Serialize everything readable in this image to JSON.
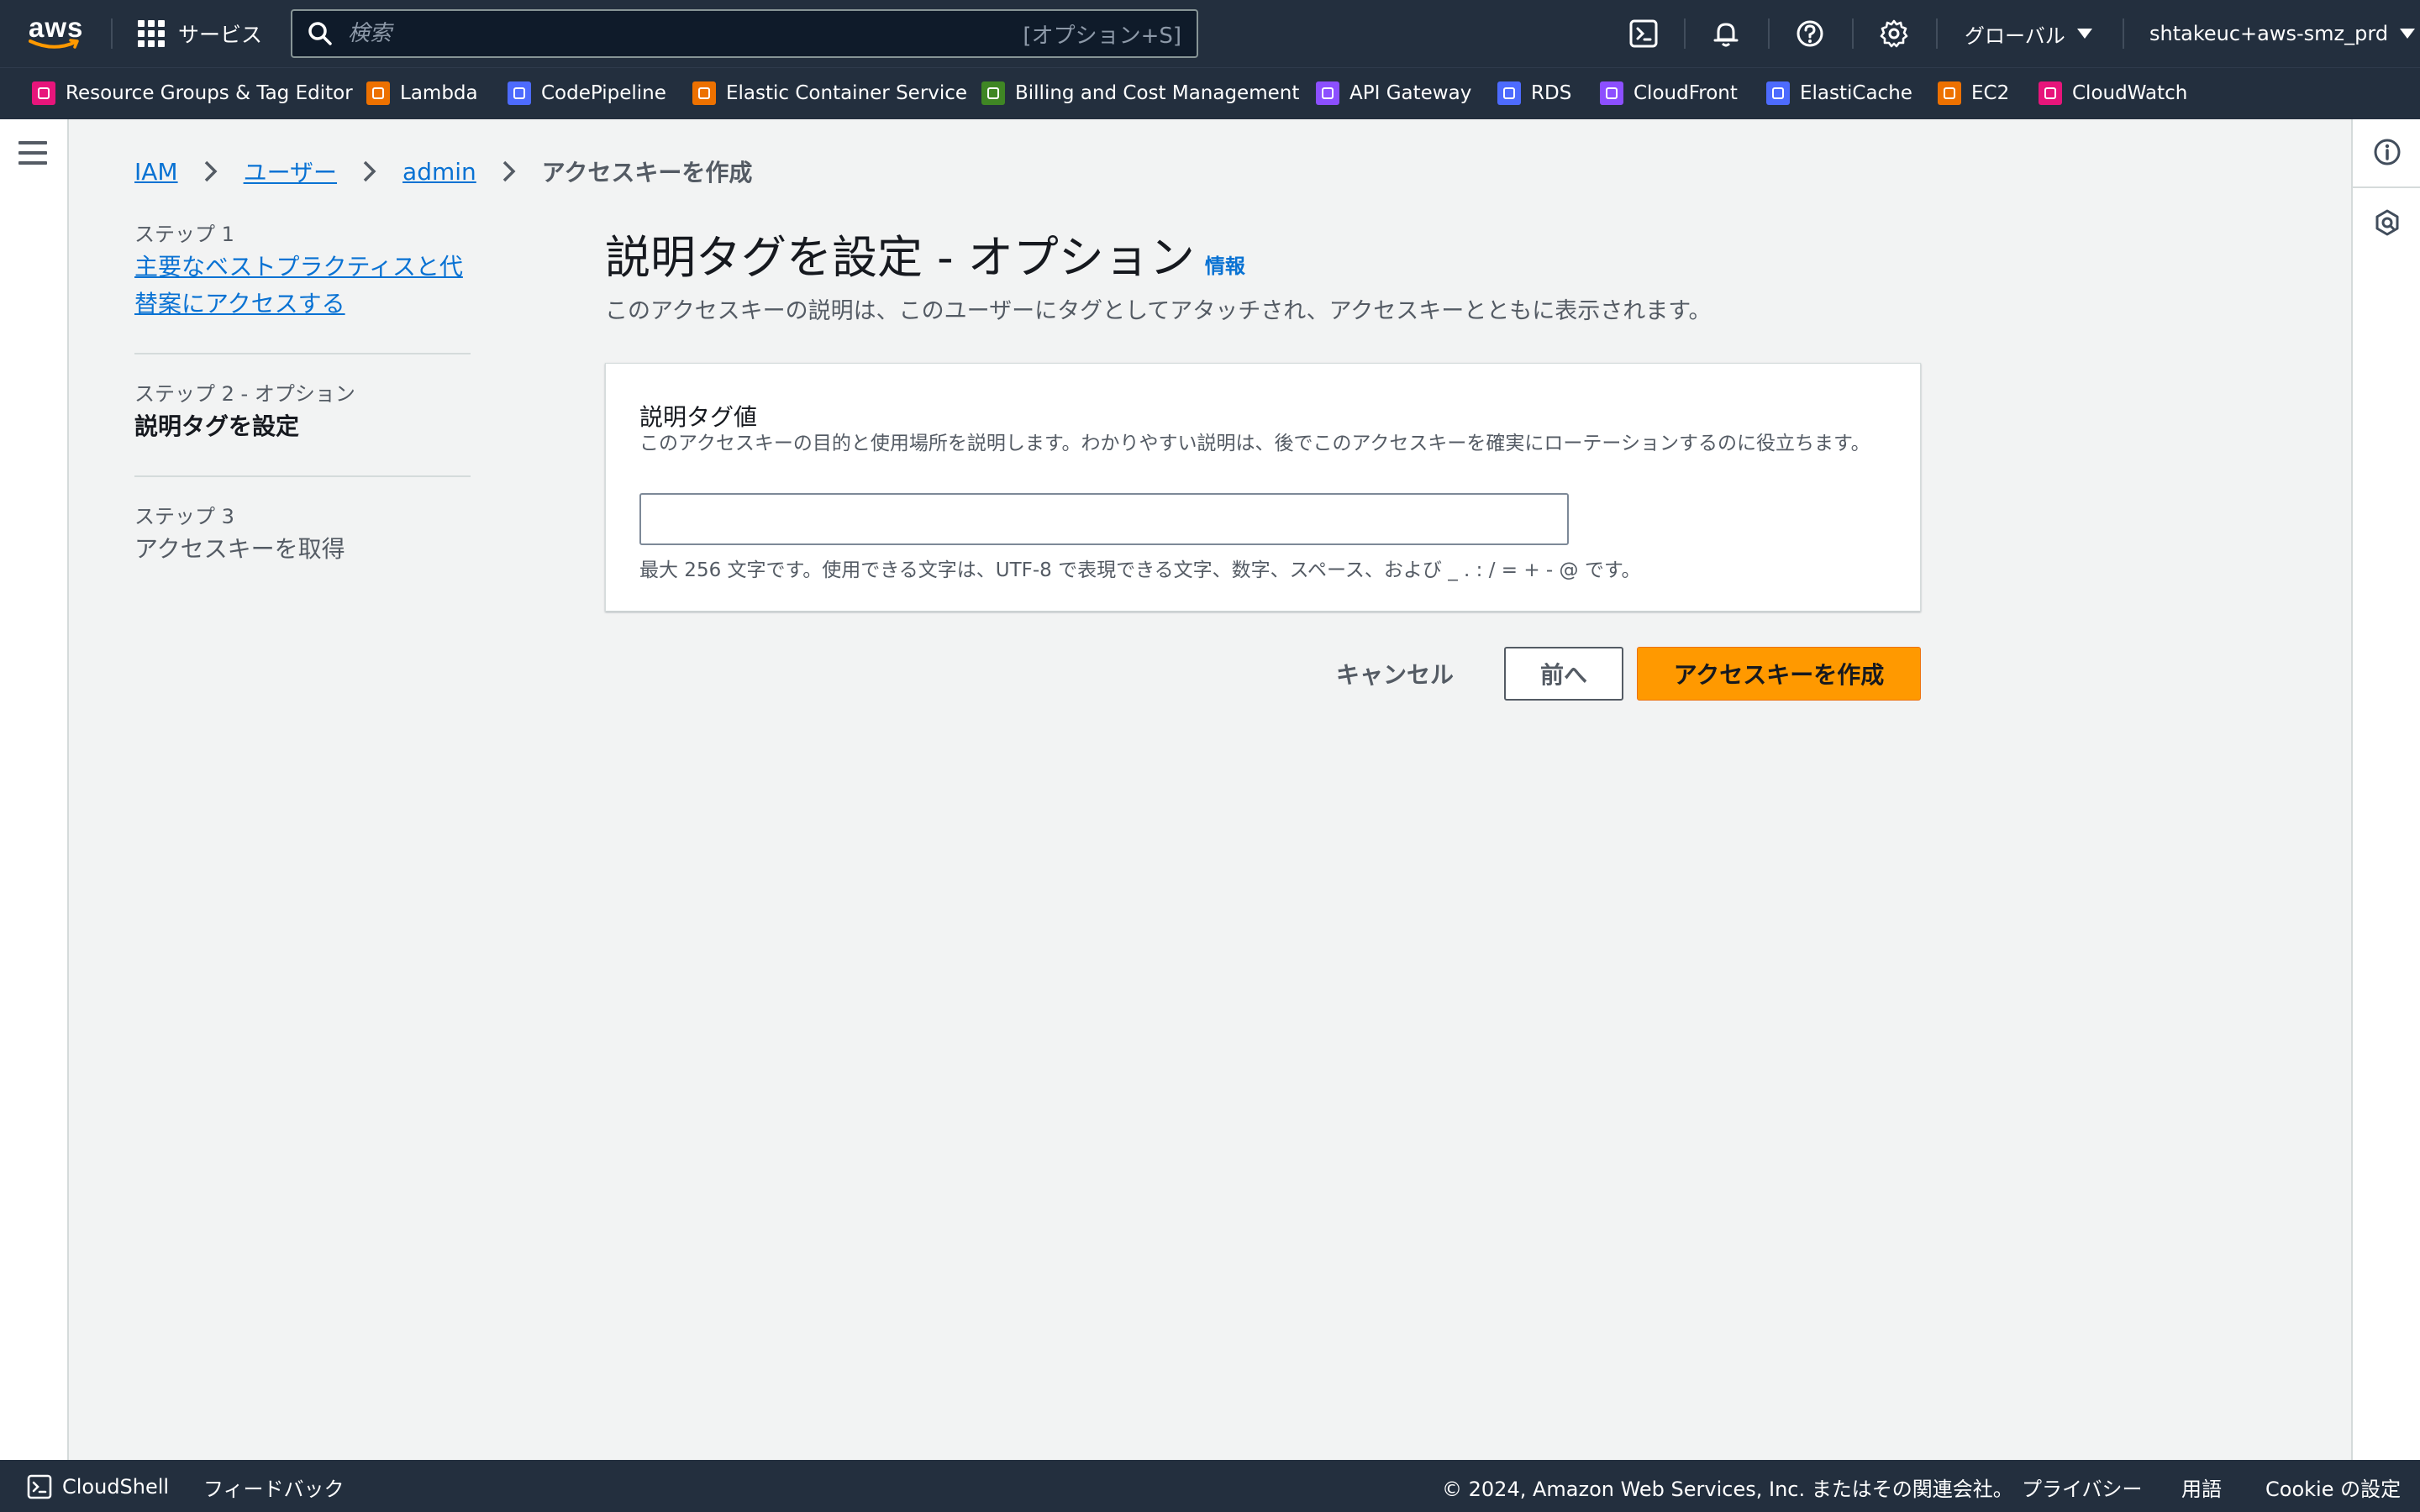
{
  "topnav": {
    "logo_text": "aws",
    "services_label": "サービス",
    "search_placeholder": "検索",
    "search_shortcut": "[オプション+S]",
    "region_label": "グローバル",
    "account_label": "shtakeuc+aws-smz_prd",
    "icons": [
      "cloudshell-icon",
      "bell-icon",
      "help-icon",
      "settings-icon"
    ]
  },
  "favorites": [
    {
      "label": "Resource Groups & Tag Editor",
      "color": "#e7157b"
    },
    {
      "label": "Lambda",
      "color": "#ed7100"
    },
    {
      "label": "CodePipeline",
      "color": "#4d6bfe"
    },
    {
      "label": "Elastic Container Service",
      "color": "#ed7100"
    },
    {
      "label": "Billing and Cost Management",
      "color": "#3f8624"
    },
    {
      "label": "API Gateway",
      "color": "#8c4fff"
    },
    {
      "label": "RDS",
      "color": "#4d6bfe"
    },
    {
      "label": "CloudFront",
      "color": "#8c4fff"
    },
    {
      "label": "ElastiCache",
      "color": "#4d6bfe"
    },
    {
      "label": "EC2",
      "color": "#ed7100"
    },
    {
      "label": "CloudWatch",
      "color": "#e7157b"
    }
  ],
  "breadcrumb": {
    "items": [
      "IAM",
      "ユーザー",
      "admin"
    ],
    "current": "アクセスキーを作成"
  },
  "steps": [
    {
      "label": "ステップ 1",
      "title": "主要なベストプラクティスと代替案にアクセスする",
      "title_line1": "主要なベストプラクティスと代",
      "title_line2": "替案にアクセスする",
      "state": "link"
    },
    {
      "label": "ステップ 2 - オプション",
      "title": "説明タグを設定",
      "state": "current"
    },
    {
      "label": "ステップ 3",
      "title": "アクセスキーを取得",
      "state": "disabled"
    }
  ],
  "main": {
    "title": "説明タグを設定 - オプション",
    "info_link": "情報",
    "description": "このアクセスキーの説明は、このユーザーにタグとしてアタッチされ、アクセスキーとともに表示されます。",
    "field": {
      "label": "説明タグ値",
      "description": "このアクセスキーの目的と使用場所を説明します。わかりやすい説明は、後でこのアクセスキーを確実にローテーションするのに役立ちます。",
      "value": "",
      "constraint": "最大 256 文字です。使用できる文字は、UTF-8 で表現できる文字、数字、スペース、および _ . : / = + - @ です。"
    },
    "buttons": {
      "cancel": "キャンセル",
      "previous": "前へ",
      "primary": "アクセスキーを作成"
    }
  },
  "footer": {
    "cloudshell": "CloudShell",
    "feedback": "フィードバック",
    "copyright": "© 2024, Amazon Web Services, Inc. またはその関連会社。",
    "privacy": "プライバシー",
    "terms": "用語",
    "cookie": "Cookie の設定"
  },
  "colors": {
    "nav_bg": "#232f3e",
    "link": "#0972d3",
    "primary_button": "#ff9900"
  }
}
